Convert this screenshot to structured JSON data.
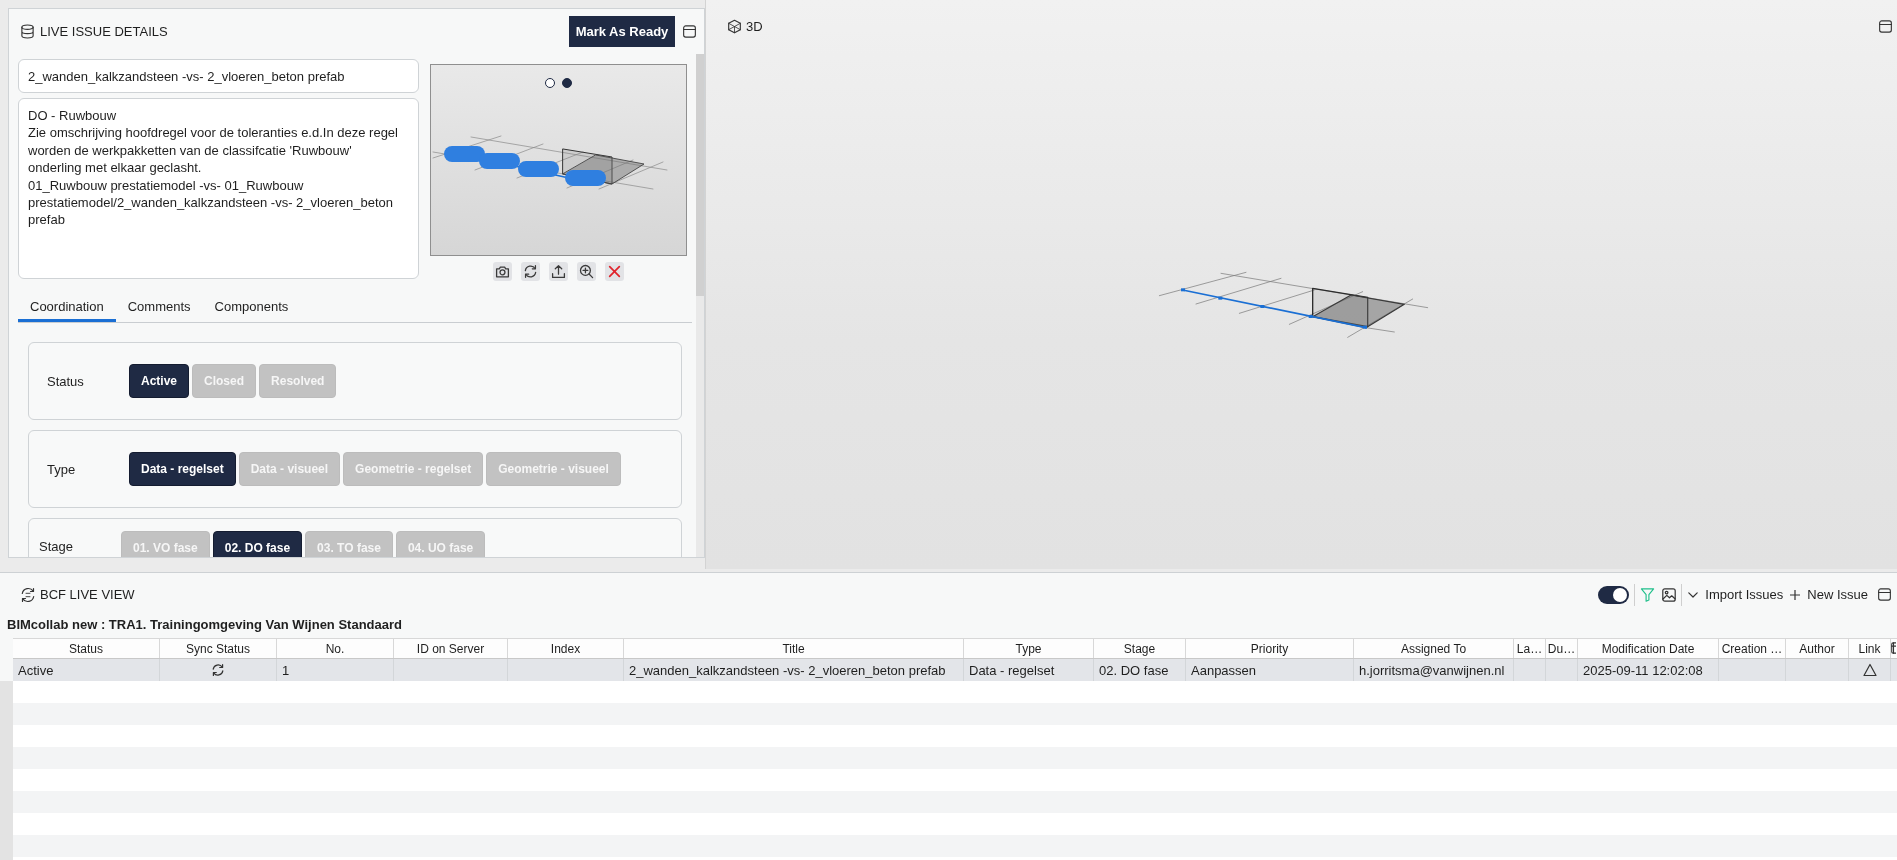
{
  "details_panel": {
    "title": "LIVE ISSUE DETAILS",
    "mark_ready_button": "Mark As Ready",
    "issue_title": "2_wanden_kalkzandsteen -vs- 2_vloeren_beton prefab",
    "description": "DO - Ruwbouw\nZie omschrijving hoofdregel voor de toleranties e.d.In deze regel worden de werkpakketten van de classifcatie 'Ruwbouw' onderling met elkaar geclasht.\n01_Ruwbouw prestatiemodel -vs- 01_Ruwbouw prestatiemodel/2_wanden_kalkzandsteen -vs- 2_vloeren_beton prefab",
    "viewpoints": [
      {
        "selected": false
      },
      {
        "selected": true
      }
    ],
    "tabs": [
      {
        "label": "Coordination",
        "selected": true
      },
      {
        "label": "Comments",
        "selected": false
      },
      {
        "label": "Components",
        "selected": false
      }
    ],
    "fields": [
      {
        "label": "Status",
        "options": [
          {
            "label": "Active",
            "selected": true
          },
          {
            "label": "Closed",
            "selected": false
          },
          {
            "label": "Resolved",
            "selected": false
          }
        ]
      },
      {
        "label": "Type",
        "options": [
          {
            "label": "Data - regelset",
            "selected": true
          },
          {
            "label": "Data - visueel",
            "selected": false
          },
          {
            "label": "Geometrie - regelset",
            "selected": false
          },
          {
            "label": "Geometrie - visueel",
            "selected": false
          }
        ]
      },
      {
        "label": "Stage",
        "options": [
          {
            "label": "01. VO fase",
            "selected": false
          },
          {
            "label": "02. DO fase",
            "selected": true
          },
          {
            "label": "03. TO fase",
            "selected": false
          },
          {
            "label": "04. UO fase",
            "selected": false
          }
        ]
      }
    ]
  },
  "viewer": {
    "title": "3D"
  },
  "bcf_panel": {
    "title": "BCF LIVE VIEW",
    "toggle": {
      "on": true
    },
    "import_button": "Import Issues",
    "new_issue_button": "New Issue",
    "project": "BIMcollab new : TRA1. Trainingomgeving Van Wijnen Standaard",
    "columns": [
      "Status",
      "Sync Status",
      "No.",
      "ID on Server",
      "Index",
      "Title",
      "Type",
      "Stage",
      "Priority",
      "Assigned To",
      "La…",
      "Du…",
      "Modification Date",
      "Creation …",
      "Author",
      "Link"
    ],
    "rows": [
      {
        "selected": true,
        "status": "Active",
        "no": "1",
        "title": "2_wanden_kalkzandsteen -vs- 2_vloeren_beton prefab",
        "type": "Data - regelset",
        "stage": "02. DO fase",
        "priority": "Aanpassen",
        "assigned_to": "h.jorritsma@vanwijnen.nl",
        "modification_date": "2025-09-11 12:02:08"
      }
    ]
  }
}
